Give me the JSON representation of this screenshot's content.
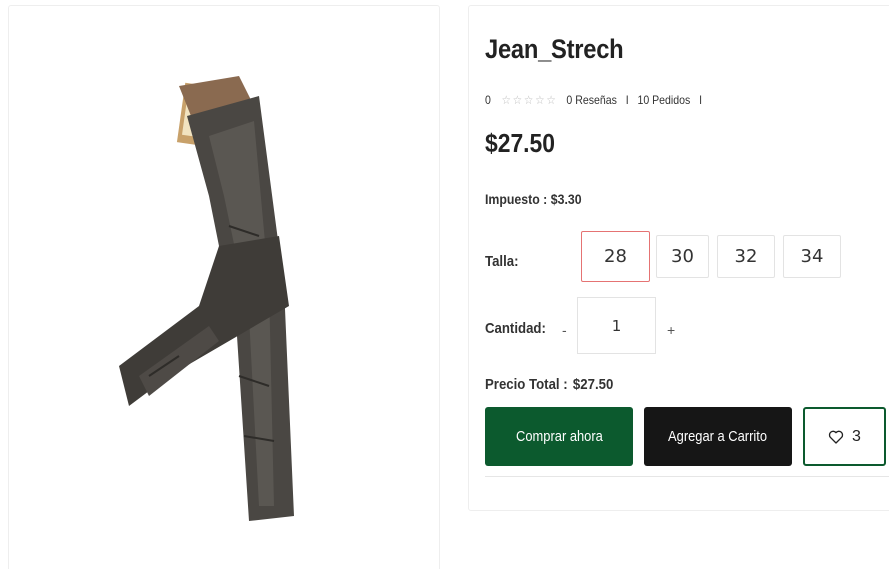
{
  "product": {
    "title": "Jean_Strech",
    "rating_value": "0",
    "stars": [
      "☆",
      "☆",
      "☆",
      "☆",
      "☆"
    ],
    "reviews": "0 Reseñas",
    "orders": "10 Pedidos",
    "separator": "I",
    "price": "$27.50",
    "tax_label": "Impuesto :",
    "tax_value": "$3.30",
    "image_icon": "jeans-image"
  },
  "size": {
    "label": "Talla:",
    "options": [
      "28",
      "30",
      "32",
      "34"
    ],
    "selected": "28",
    "selected_color": "#e57373"
  },
  "quantity": {
    "label": "Cantidad:",
    "minus": "-",
    "value": "1",
    "plus": "+"
  },
  "total": {
    "label": "Precio Total :",
    "value": "$27.50"
  },
  "actions": {
    "buy_label": "Comprar ahora",
    "cart_label": "Agregar a Carrito",
    "wishlist_count": "3",
    "wishlist_icon": "heart-outline-icon"
  },
  "colors": {
    "primary_green": "#0c5a2e",
    "dark_button": "#161616"
  }
}
